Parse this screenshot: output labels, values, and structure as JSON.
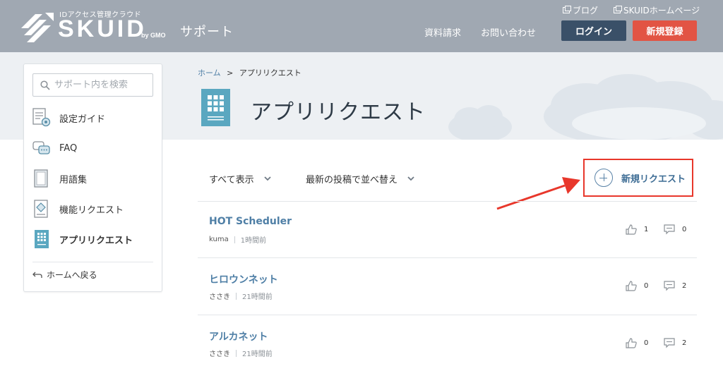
{
  "header": {
    "logo_tagline": "IDアクセス管理クラウド",
    "logo_name": "SKUID",
    "logo_by": "by GMO",
    "site_name": "サポート",
    "top_links": [
      "ブログ",
      "SKUIDホームページ"
    ],
    "nav": [
      "資料請求",
      "お問い合わせ"
    ],
    "login_label": "ログイン",
    "signup_label": "新規登録",
    "colors": {
      "bar": "#a0a8b2",
      "login": "#3a5068",
      "signup": "#e25444"
    }
  },
  "sidebar": {
    "search_placeholder": "サポート内を検索",
    "items": [
      {
        "label": "設定ガイド",
        "icon": "guide-icon"
      },
      {
        "label": "FAQ",
        "icon": "faq-icon"
      },
      {
        "label": "用語集",
        "icon": "glossary-icon"
      },
      {
        "label": "機能リクエスト",
        "icon": "feature-request-icon"
      },
      {
        "label": "アプリリクエスト",
        "icon": "app-request-icon",
        "active": true
      }
    ],
    "back_label": "ホームへ戻る"
  },
  "breadcrumb": {
    "home": "ホーム",
    "separator": ">",
    "current": "アプリリクエスト"
  },
  "page": {
    "title": "アプリリクエスト",
    "filter_all": "すべて表示",
    "filter_sort": "最新の投稿で並べ替え",
    "new_request_label": "新規リクエスト",
    "highlight_color": "#e8372b"
  },
  "requests": [
    {
      "title": "HOT Scheduler",
      "author": "kuma",
      "time": "1時間前",
      "likes": "1",
      "comments": "0"
    },
    {
      "title": "ヒロウンネット",
      "author": "ささき",
      "time": "21時間前",
      "likes": "0",
      "comments": "2"
    },
    {
      "title": "アルカネット",
      "author": "ささき",
      "time": "21時間前",
      "likes": "0",
      "comments": "2"
    }
  ]
}
